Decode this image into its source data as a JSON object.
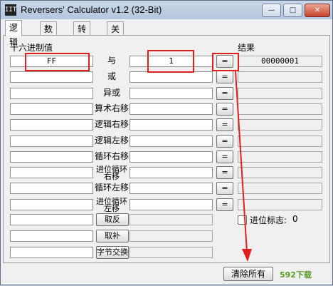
{
  "window": {
    "title": "Reversers' Calculator v1.2 (32-Bit)",
    "app_icon_text": "IIT"
  },
  "controls": {
    "minimize": "—",
    "maximize": "□",
    "close": "✕"
  },
  "tabs": [
    "逻辑",
    "数学",
    "转换",
    "关于"
  ],
  "labels": {
    "hex": "十六进制值",
    "result": "结果",
    "carry_flag": "进位标志:",
    "carry_value": "0"
  },
  "input_a": "FF",
  "input_b": "1",
  "results": [
    "00000001",
    "",
    "",
    "",
    "",
    "",
    "",
    "",
    "",
    ""
  ],
  "ops": [
    "与",
    "或",
    "异或",
    "算术右移",
    "逻辑右移",
    "逻辑左移",
    "循环右移",
    "进位循环右移",
    "循环左移",
    "进位循环左移"
  ],
  "unary_ops": [
    "取反",
    "取补",
    "字节交换"
  ],
  "eq_label": "=",
  "clear_all": "清除所有",
  "watermark": "592下载",
  "colors": {
    "highlight": "#e02020",
    "arrow": "#e02020"
  }
}
